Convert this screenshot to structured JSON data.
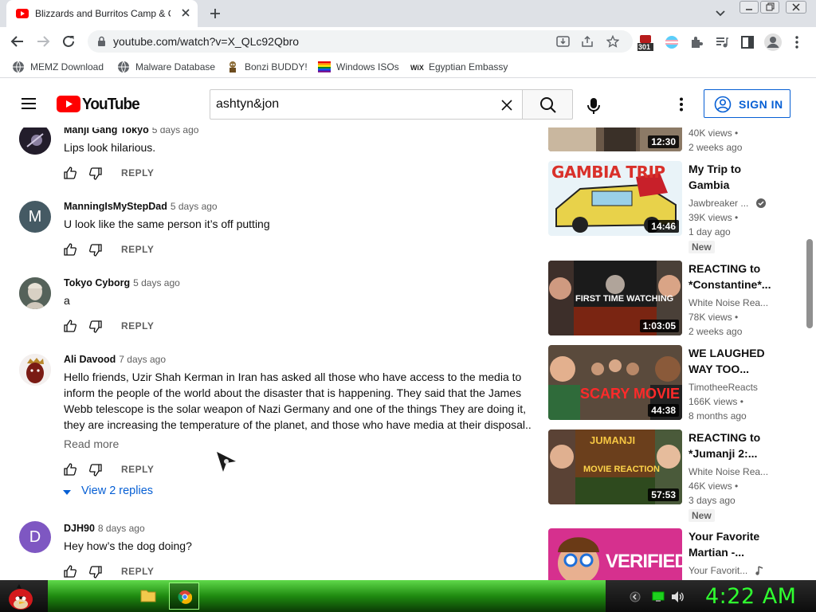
{
  "browser": {
    "tab_title": "Blizzards and Burritos Camp & C",
    "url": "youtube.com/watch?v=X_QLc92Qbro",
    "ext_badge": "301",
    "bookmarks": [
      {
        "label": "MEMZ Download",
        "icon": "globe-icon"
      },
      {
        "label": "Malware Database",
        "icon": "globe-icon"
      },
      {
        "label": "Bonzi BUDDY!",
        "icon": "bonzi-icon"
      },
      {
        "label": "Windows ISOs",
        "icon": "windows-flag-icon"
      },
      {
        "label": "Egyptian Embassy",
        "icon": "wix-icon"
      }
    ]
  },
  "youtube": {
    "logo_text": "YouTube",
    "search_value": "ashtyn&jon",
    "signin_label": "SIGN IN",
    "accent": "#065fd4",
    "brand_red": "#ff0000"
  },
  "comments": [
    {
      "author": "Manji Gang Tokyo",
      "time": "5 days ago",
      "text": "Lips look hilarious.",
      "reply": "REPLY"
    },
    {
      "author": "ManningIsMyStepDad",
      "time": "5 days ago",
      "text": "U look like the same person it’s off putting",
      "reply": "REPLY",
      "initial": "M",
      "avatar_color": "#455a64"
    },
    {
      "author": "Tokyo Cyborg",
      "time": "5 days ago",
      "text": "a",
      "reply": "REPLY"
    },
    {
      "author": "Ali Davood",
      "time": "7 days ago",
      "lines": [
        "Hello friends, Uzir Shah Kerman in Iran has asked all those who have access to the media to",
        "inform the people of the world about the disaster that is happening. They said that the James",
        "Webb telescope is the solar weapon of Nazi Germany and one of the things They are doing it,",
        "they are increasing the temperature of the planet, and those who have media at their disposal..."
      ],
      "read_more": "Read more",
      "reply": "REPLY",
      "view_replies": "View 2 replies"
    },
    {
      "author": "DJH90",
      "time": "8 days ago",
      "text": "Hey how’s the dog doing?",
      "reply": "REPLY",
      "initial": "D",
      "avatar_color": "#7e57c2"
    }
  ],
  "recommendations": [
    {
      "title": "",
      "channel": "",
      "views": "40K views",
      "age": "2 weeks ago",
      "duration": "12:30"
    },
    {
      "title_lines": [
        "My Trip to",
        "Gambia"
      ],
      "channel": "Jawbreaker ...",
      "verified": true,
      "views": "39K views",
      "age": "1 day ago",
      "badge": "New",
      "duration": "14:46",
      "thumb_text": "GAMBIA TRIP"
    },
    {
      "title_lines": [
        "REACTING to",
        "*Constantine*..."
      ],
      "channel": "White Noise Rea...",
      "views": "78K views",
      "age": "2 weeks ago",
      "duration": "1:03:05",
      "thumb_text": "FIRST TIME WATCHING"
    },
    {
      "title_lines": [
        "WE LAUGHED",
        "WAY TOO..."
      ],
      "channel": "TimotheeReacts",
      "views": "166K views",
      "age": "8 months ago",
      "duration": "44:38",
      "thumb_text": "SCARY MOVIE 3"
    },
    {
      "title_lines": [
        "REACTING to",
        "*Jumanji 2:..."
      ],
      "channel": "White Noise Rea...",
      "views": "46K views",
      "age": "3 days ago",
      "badge": "New",
      "duration": "57:53",
      "thumb_text": "MOVIE REACTION",
      "thumb_text2": "JUMANJI"
    },
    {
      "title_lines": [
        "Your Favorite",
        "Martian -..."
      ],
      "channel": "Your Favorit...",
      "views": "",
      "age": "",
      "duration": "",
      "thumb_text": "VERIFIED"
    }
  ],
  "taskbar": {
    "clock": "4:22 AM"
  }
}
